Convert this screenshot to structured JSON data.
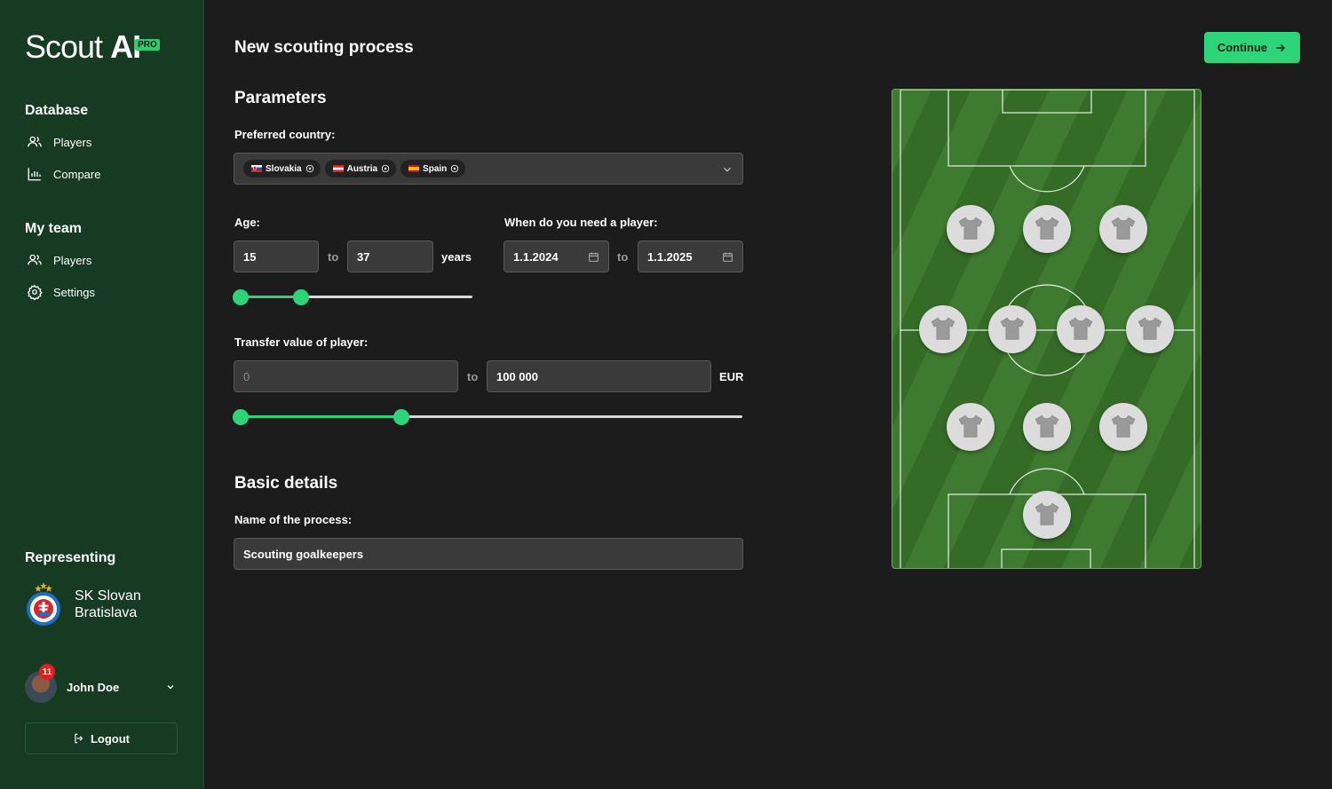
{
  "app": {
    "logo_main": "Scout",
    "logo_bold": "AI",
    "logo_badge": "PRO"
  },
  "sidebar": {
    "database_title": "Database",
    "database_items": [
      {
        "label": "Players",
        "icon": "users-icon"
      },
      {
        "label": "Compare",
        "icon": "bar-chart-icon"
      }
    ],
    "myteam_title": "My team",
    "myteam_items": [
      {
        "label": "Players",
        "icon": "users-icon"
      },
      {
        "label": "Settings",
        "icon": "gear-icon"
      }
    ],
    "representing_title": "Representing",
    "club_name": "SK Slovan Bratislava",
    "user": {
      "name": "John Doe",
      "notifications": "11"
    },
    "logout_label": "Logout"
  },
  "header": {
    "title": "New scouting process",
    "continue_label": "Continue"
  },
  "parameters": {
    "title": "Parameters",
    "country_label": "Preferred country:",
    "countries": [
      {
        "name": "Slovakia",
        "flag": "slovakia-flag"
      },
      {
        "name": "Austria",
        "flag": "austria-flag"
      },
      {
        "name": "Spain",
        "flag": "spain-flag"
      }
    ],
    "age_label": "Age:",
    "age_from": "15",
    "age_to": "37",
    "age_unit": "years",
    "to_label": "to",
    "need_label": "When do you need a player:",
    "date_from": "1.1.2024",
    "date_to": "1.1.2025",
    "transfer_label": "Transfer value of player:",
    "transfer_from_placeholder": "0",
    "transfer_to": "100 000",
    "currency": "EUR",
    "age_slider": {
      "from_fraction": 0.0,
      "to_fraction": 0.26
    },
    "transfer_slider": {
      "from_fraction": 0.0,
      "to_fraction": 0.32
    }
  },
  "basic": {
    "title": "Basic details",
    "name_label": "Name of the process:",
    "name_value": "Scouting goalkeepers"
  },
  "colors": {
    "accent": "#2ed47a",
    "sidebar": "#163a22",
    "background": "#1c1c1c"
  }
}
